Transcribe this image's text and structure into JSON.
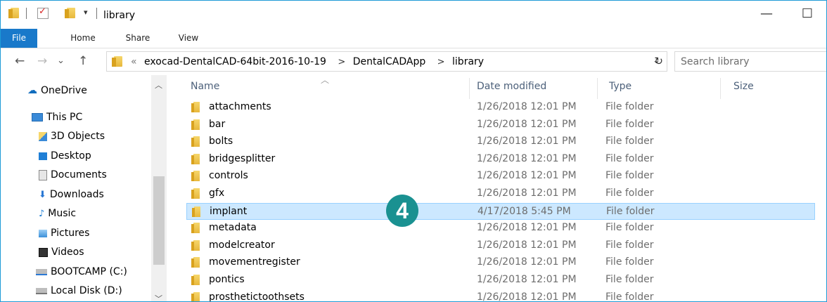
{
  "window": {
    "title": "library",
    "minimize_symbol": "—",
    "maximize_symbol": "☐"
  },
  "ribbon": {
    "tabs": [
      "File",
      "Home",
      "Share",
      "View"
    ]
  },
  "address": {
    "back": "←",
    "forward": "→",
    "history": "⌄",
    "up": "↑",
    "overflow": "«",
    "crumbs": [
      "exocad-DentalCAD-64bit-2016-10-19",
      "DentalCADApp",
      "library"
    ],
    "crumb_separator": ">",
    "dropdown": "⌄",
    "refresh": "↻"
  },
  "search": {
    "placeholder": "Search library"
  },
  "navpane": {
    "items": [
      {
        "label": "OneDrive",
        "icon": "cloud-icon"
      },
      {
        "label": "This PC",
        "icon": "computer-icon"
      },
      {
        "label": "3D Objects",
        "icon": "3d-objects-icon"
      },
      {
        "label": "Desktop",
        "icon": "desktop-icon"
      },
      {
        "label": "Documents",
        "icon": "documents-icon"
      },
      {
        "label": "Downloads",
        "icon": "downloads-icon"
      },
      {
        "label": "Music",
        "icon": "music-icon"
      },
      {
        "label": "Pictures",
        "icon": "pictures-icon"
      },
      {
        "label": "Videos",
        "icon": "videos-icon"
      },
      {
        "label": "BOOTCAMP (C:)",
        "icon": "drive-icon"
      },
      {
        "label": "Local Disk (D:)",
        "icon": "drive-icon"
      }
    ]
  },
  "columns": {
    "name": "Name",
    "date": "Date modified",
    "type": "Type",
    "size": "Size"
  },
  "files": [
    {
      "name": "attachments",
      "date": "1/26/2018 12:01 PM",
      "type": "File folder"
    },
    {
      "name": "bar",
      "date": "1/26/2018 12:01 PM",
      "type": "File folder"
    },
    {
      "name": "bolts",
      "date": "1/26/2018 12:01 PM",
      "type": "File folder"
    },
    {
      "name": "bridgesplitter",
      "date": "1/26/2018 12:01 PM",
      "type": "File folder"
    },
    {
      "name": "controls",
      "date": "1/26/2018 12:01 PM",
      "type": "File folder"
    },
    {
      "name": "gfx",
      "date": "1/26/2018 12:01 PM",
      "type": "File folder"
    },
    {
      "name": "implant",
      "date": "4/17/2018 5:45 PM",
      "type": "File folder",
      "selected": true
    },
    {
      "name": "metadata",
      "date": "1/26/2018 12:01 PM",
      "type": "File folder"
    },
    {
      "name": "modelcreator",
      "date": "1/26/2018 12:01 PM",
      "type": "File folder"
    },
    {
      "name": "movementregister",
      "date": "1/26/2018 12:01 PM",
      "type": "File folder"
    },
    {
      "name": "pontics",
      "date": "1/26/2018 12:01 PM",
      "type": "File folder"
    },
    {
      "name": "prosthetictoothsets",
      "date": "1/26/2018 12:01 PM",
      "type": "File folder"
    }
  ],
  "annotation": {
    "step": "4"
  },
  "colors": {
    "accent": "#1979ca",
    "frame": "#1e9bd7",
    "selection": "#cce8ff",
    "badge": "#1a9191"
  }
}
